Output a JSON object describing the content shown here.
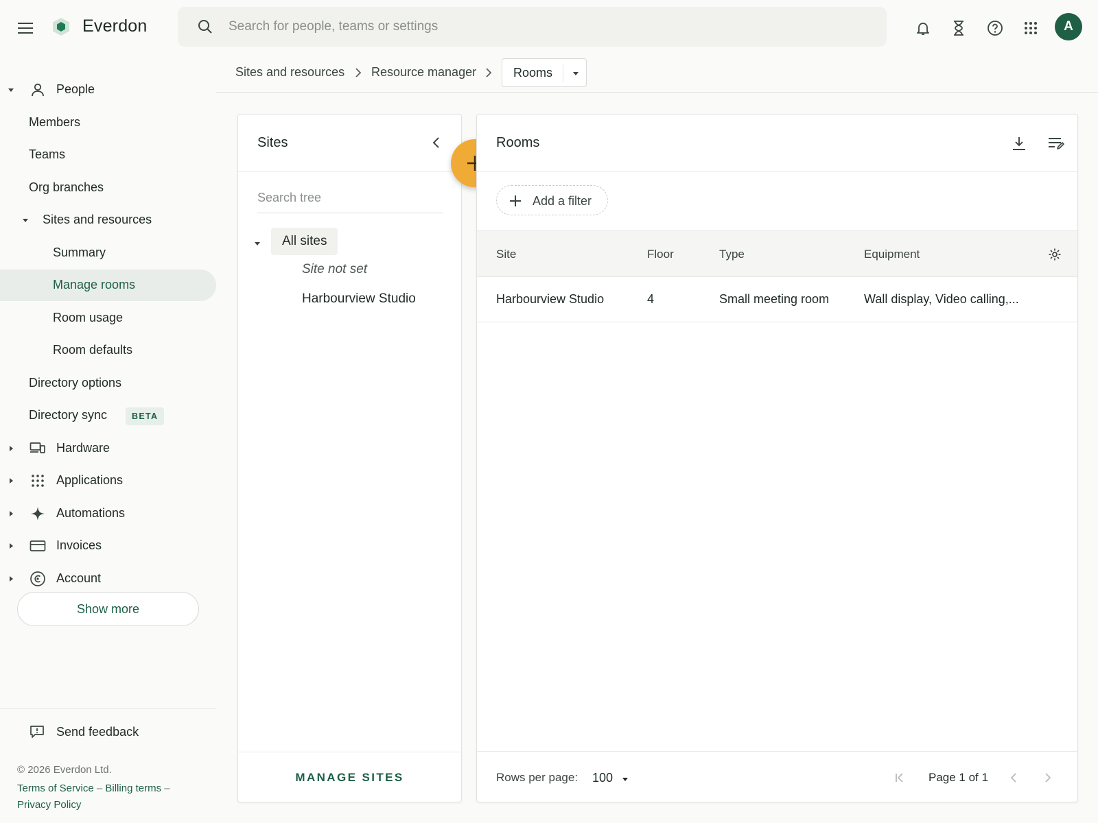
{
  "app": {
    "brand": "Everdon",
    "user_initial": "A",
    "accent_color": "#1e5f46",
    "fab_color": "#f0aa36"
  },
  "search": {
    "placeholder": "Search for people, teams or settings",
    "value": ""
  },
  "top_icons": [
    "bell-icon",
    "hourglass-icon",
    "help-icon",
    "apps-grid-icon"
  ],
  "sidebar": {
    "people": "People",
    "members": "Members",
    "teams": "Teams",
    "org_branches": "Org branches",
    "sites_and_resources": "Sites and resources",
    "summary": "Summary",
    "manage_rooms": "Manage rooms",
    "room_usage": "Room usage",
    "room_defaults": "Room defaults",
    "directory_options": "Directory options",
    "directory_sync": "Directory sync",
    "beta_badge": "BETA",
    "hardware": "Hardware",
    "applications": "Applications",
    "automations": "Automations",
    "invoices": "Invoices",
    "account": "Account",
    "show_more": "Show more",
    "send_feedback": "Send feedback",
    "copyright": "© 2026 Everdon Ltd.",
    "terms": "Terms of Service",
    "billing": "Billing terms",
    "privacy": "Privacy Policy",
    "legal_sep": "–"
  },
  "breadcrumb": {
    "items": [
      "Sites and resources",
      "Resource manager"
    ],
    "current": "Rooms"
  },
  "sites_panel": {
    "title": "Sites",
    "search_placeholder": "Search tree",
    "root": "All sites",
    "children": [
      "Site not set",
      "Harbourview Studio"
    ],
    "manage_sites": "MANAGE SITES"
  },
  "rooms_panel": {
    "title": "Rooms",
    "add_filter": "Add a filter",
    "columns": {
      "site": "Site",
      "floor": "Floor",
      "type": "Type",
      "equipment": "Equipment"
    },
    "rows": [
      {
        "site": "Harbourview Studio",
        "floor": "4",
        "type": "Small meeting room",
        "equipment": "Wall display, Video calling,..."
      }
    ],
    "rows_per_page_label": "Rows per page:",
    "rows_per_page": "100",
    "page_text": "Page 1 of 1"
  }
}
